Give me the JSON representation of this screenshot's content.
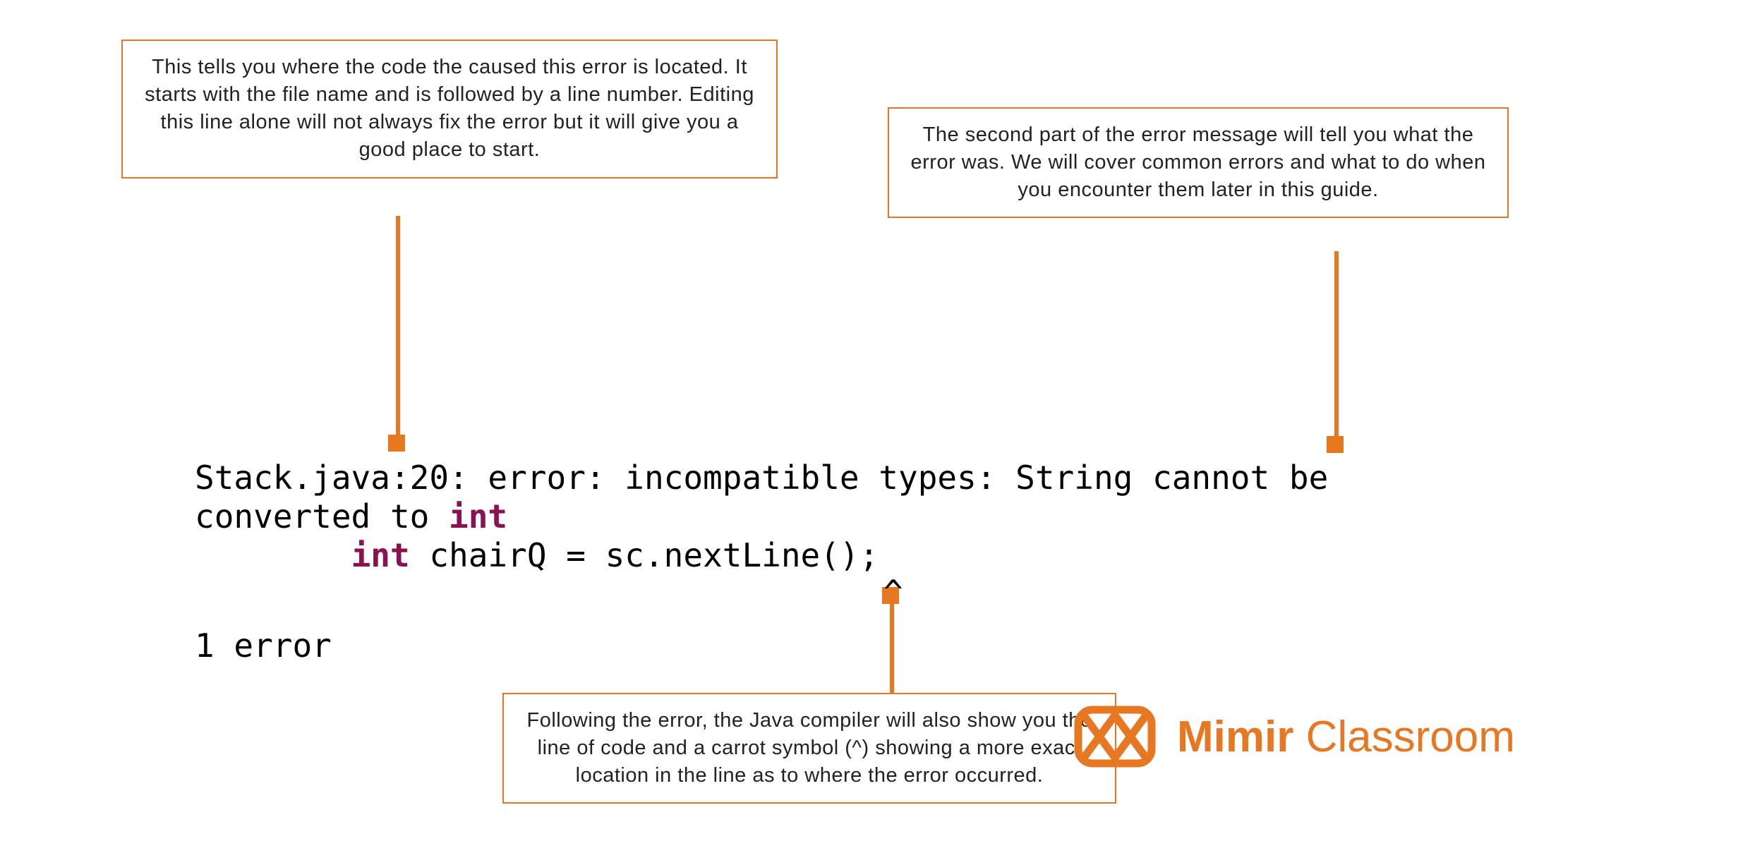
{
  "callouts": {
    "topLeft": "This tells you where the code the caused this error is located. It starts with the file name and is followed by a line number. Editing this line alone will not always fix the error but it will give you a good place to start.",
    "topRight": "The second part of the error message will tell you what the error was. We will cover common errors and what to do when you encounter them later in this guide.",
    "bottom": "Following the error, the Java compiler will also show you the line of code and a carrot symbol (^) showing a more exact location in the line as to where the error occurred."
  },
  "code": {
    "line1_a": "Stack.java:20: error: incompatible types: String cannot be",
    "line2_a": "converted to ",
    "line2_kw": "int",
    "line3_pad": "        ",
    "line3_kw": "int",
    "line3_rest": " chairQ = sc.nextLine();",
    "caret": "^",
    "summary": "1 error"
  },
  "logo": {
    "brandBold": "Mimir",
    "brandLight": " Classroom"
  },
  "colors": {
    "accent": "#e87722",
    "keyword": "#8a1253"
  }
}
